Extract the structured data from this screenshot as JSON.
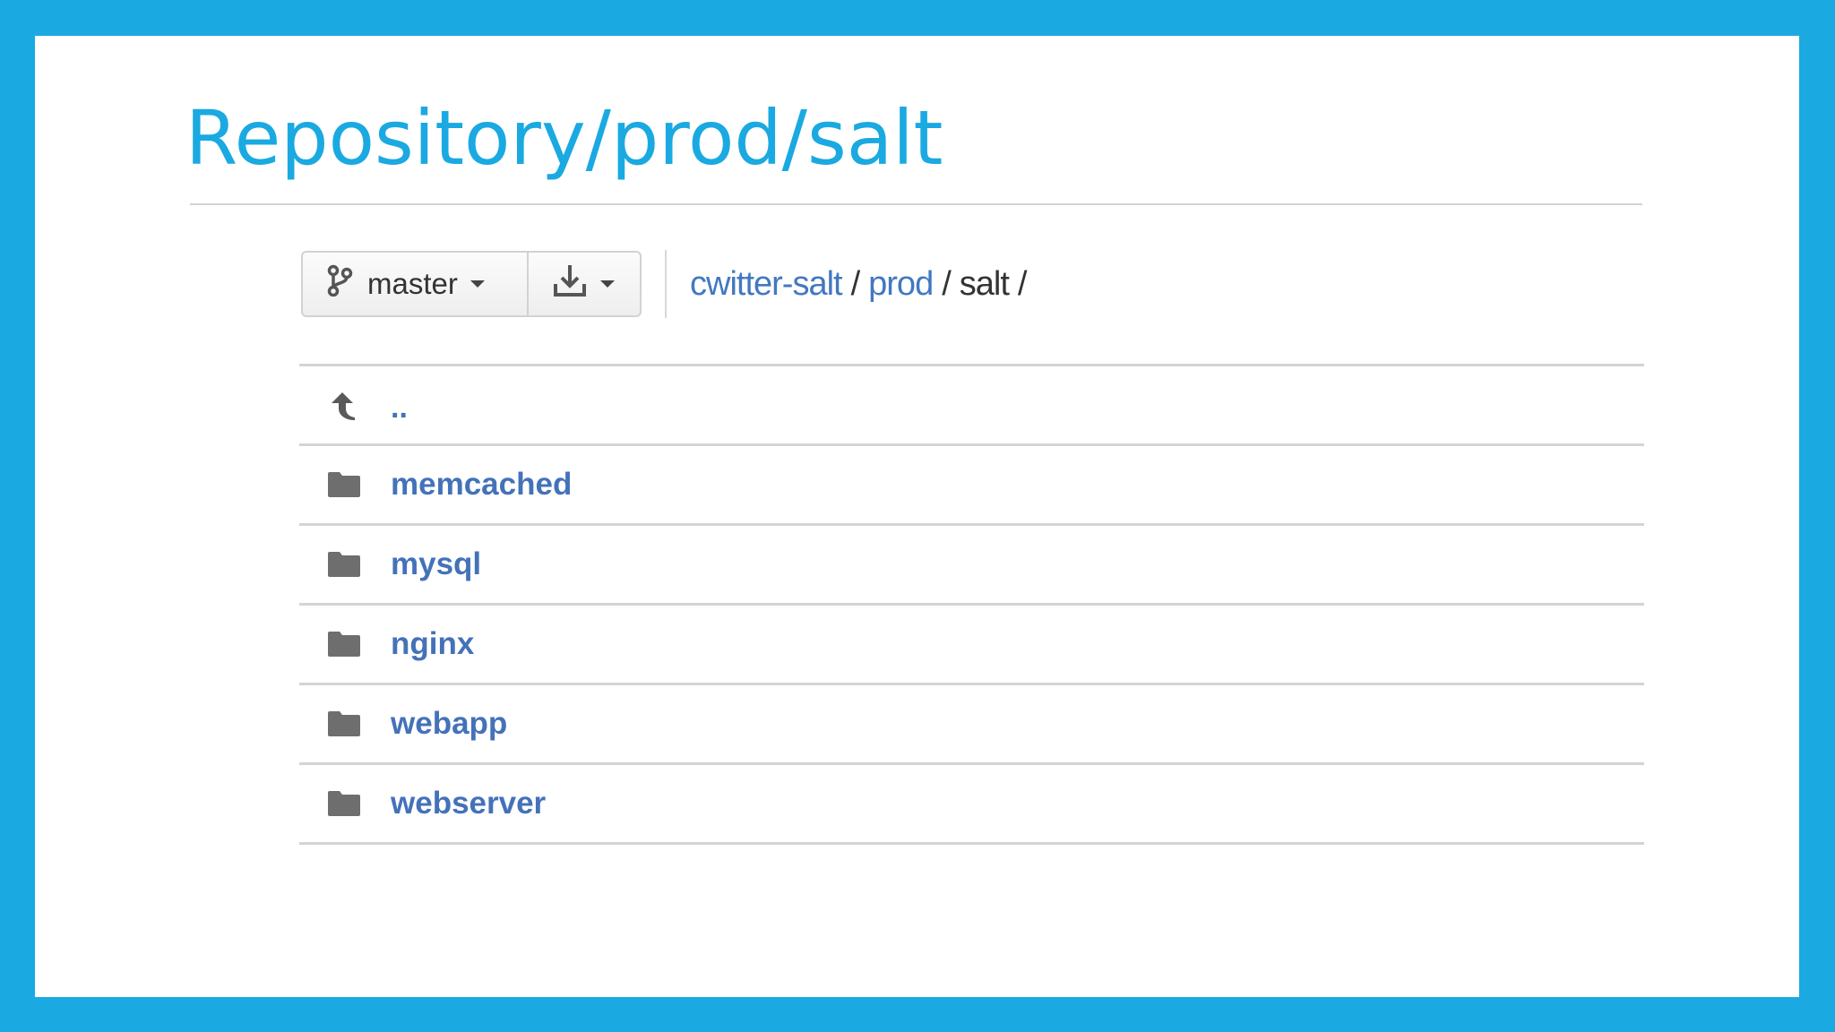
{
  "slide": {
    "title": "Repository/prod/salt"
  },
  "toolbar": {
    "branch_label": "master",
    "branch_icon": "git-branch-icon",
    "download_icon": "download-icon"
  },
  "breadcrumb": {
    "items": [
      {
        "label": "cwitter-salt",
        "link": true
      },
      {
        "label": "prod",
        "link": true
      },
      {
        "label": "salt",
        "link": false
      }
    ],
    "separator": "/"
  },
  "file_list": {
    "parent": {
      "label": "..",
      "icon": "arrow-up-icon"
    },
    "folders": [
      {
        "name": "memcached",
        "icon": "folder-icon"
      },
      {
        "name": "mysql",
        "icon": "folder-icon"
      },
      {
        "name": "nginx",
        "icon": "folder-icon"
      },
      {
        "name": "webapp",
        "icon": "folder-icon"
      },
      {
        "name": "webserver",
        "icon": "folder-icon"
      }
    ]
  },
  "colors": {
    "frame": "#1aa9e1",
    "title": "#1aa9e1",
    "link": "#4472b9",
    "icon": "#6e6e6e"
  }
}
